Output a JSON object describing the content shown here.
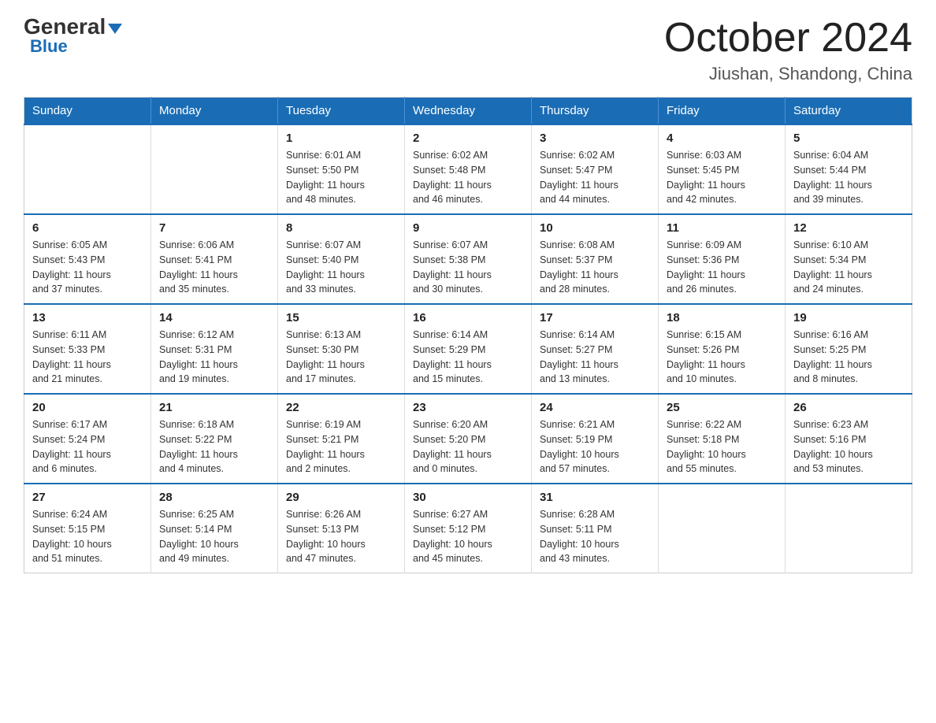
{
  "header": {
    "logo_general": "General",
    "logo_blue": "Blue",
    "month_title": "October 2024",
    "location": "Jiushan, Shandong, China"
  },
  "calendar": {
    "days_of_week": [
      "Sunday",
      "Monday",
      "Tuesday",
      "Wednesday",
      "Thursday",
      "Friday",
      "Saturday"
    ],
    "weeks": [
      [
        {
          "day": "",
          "info": ""
        },
        {
          "day": "",
          "info": ""
        },
        {
          "day": "1",
          "info": "Sunrise: 6:01 AM\nSunset: 5:50 PM\nDaylight: 11 hours\nand 48 minutes."
        },
        {
          "day": "2",
          "info": "Sunrise: 6:02 AM\nSunset: 5:48 PM\nDaylight: 11 hours\nand 46 minutes."
        },
        {
          "day": "3",
          "info": "Sunrise: 6:02 AM\nSunset: 5:47 PM\nDaylight: 11 hours\nand 44 minutes."
        },
        {
          "day": "4",
          "info": "Sunrise: 6:03 AM\nSunset: 5:45 PM\nDaylight: 11 hours\nand 42 minutes."
        },
        {
          "day": "5",
          "info": "Sunrise: 6:04 AM\nSunset: 5:44 PM\nDaylight: 11 hours\nand 39 minutes."
        }
      ],
      [
        {
          "day": "6",
          "info": "Sunrise: 6:05 AM\nSunset: 5:43 PM\nDaylight: 11 hours\nand 37 minutes."
        },
        {
          "day": "7",
          "info": "Sunrise: 6:06 AM\nSunset: 5:41 PM\nDaylight: 11 hours\nand 35 minutes."
        },
        {
          "day": "8",
          "info": "Sunrise: 6:07 AM\nSunset: 5:40 PM\nDaylight: 11 hours\nand 33 minutes."
        },
        {
          "day": "9",
          "info": "Sunrise: 6:07 AM\nSunset: 5:38 PM\nDaylight: 11 hours\nand 30 minutes."
        },
        {
          "day": "10",
          "info": "Sunrise: 6:08 AM\nSunset: 5:37 PM\nDaylight: 11 hours\nand 28 minutes."
        },
        {
          "day": "11",
          "info": "Sunrise: 6:09 AM\nSunset: 5:36 PM\nDaylight: 11 hours\nand 26 minutes."
        },
        {
          "day": "12",
          "info": "Sunrise: 6:10 AM\nSunset: 5:34 PM\nDaylight: 11 hours\nand 24 minutes."
        }
      ],
      [
        {
          "day": "13",
          "info": "Sunrise: 6:11 AM\nSunset: 5:33 PM\nDaylight: 11 hours\nand 21 minutes."
        },
        {
          "day": "14",
          "info": "Sunrise: 6:12 AM\nSunset: 5:31 PM\nDaylight: 11 hours\nand 19 minutes."
        },
        {
          "day": "15",
          "info": "Sunrise: 6:13 AM\nSunset: 5:30 PM\nDaylight: 11 hours\nand 17 minutes."
        },
        {
          "day": "16",
          "info": "Sunrise: 6:14 AM\nSunset: 5:29 PM\nDaylight: 11 hours\nand 15 minutes."
        },
        {
          "day": "17",
          "info": "Sunrise: 6:14 AM\nSunset: 5:27 PM\nDaylight: 11 hours\nand 13 minutes."
        },
        {
          "day": "18",
          "info": "Sunrise: 6:15 AM\nSunset: 5:26 PM\nDaylight: 11 hours\nand 10 minutes."
        },
        {
          "day": "19",
          "info": "Sunrise: 6:16 AM\nSunset: 5:25 PM\nDaylight: 11 hours\nand 8 minutes."
        }
      ],
      [
        {
          "day": "20",
          "info": "Sunrise: 6:17 AM\nSunset: 5:24 PM\nDaylight: 11 hours\nand 6 minutes."
        },
        {
          "day": "21",
          "info": "Sunrise: 6:18 AM\nSunset: 5:22 PM\nDaylight: 11 hours\nand 4 minutes."
        },
        {
          "day": "22",
          "info": "Sunrise: 6:19 AM\nSunset: 5:21 PM\nDaylight: 11 hours\nand 2 minutes."
        },
        {
          "day": "23",
          "info": "Sunrise: 6:20 AM\nSunset: 5:20 PM\nDaylight: 11 hours\nand 0 minutes."
        },
        {
          "day": "24",
          "info": "Sunrise: 6:21 AM\nSunset: 5:19 PM\nDaylight: 10 hours\nand 57 minutes."
        },
        {
          "day": "25",
          "info": "Sunrise: 6:22 AM\nSunset: 5:18 PM\nDaylight: 10 hours\nand 55 minutes."
        },
        {
          "day": "26",
          "info": "Sunrise: 6:23 AM\nSunset: 5:16 PM\nDaylight: 10 hours\nand 53 minutes."
        }
      ],
      [
        {
          "day": "27",
          "info": "Sunrise: 6:24 AM\nSunset: 5:15 PM\nDaylight: 10 hours\nand 51 minutes."
        },
        {
          "day": "28",
          "info": "Sunrise: 6:25 AM\nSunset: 5:14 PM\nDaylight: 10 hours\nand 49 minutes."
        },
        {
          "day": "29",
          "info": "Sunrise: 6:26 AM\nSunset: 5:13 PM\nDaylight: 10 hours\nand 47 minutes."
        },
        {
          "day": "30",
          "info": "Sunrise: 6:27 AM\nSunset: 5:12 PM\nDaylight: 10 hours\nand 45 minutes."
        },
        {
          "day": "31",
          "info": "Sunrise: 6:28 AM\nSunset: 5:11 PM\nDaylight: 10 hours\nand 43 minutes."
        },
        {
          "day": "",
          "info": ""
        },
        {
          "day": "",
          "info": ""
        }
      ]
    ]
  }
}
